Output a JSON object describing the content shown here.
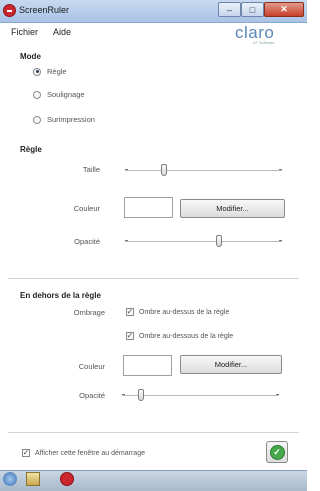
{
  "window": {
    "title": "ScreenRuler"
  },
  "menu": {
    "file": "Fichier",
    "help": "Aide"
  },
  "logo": {
    "word": "claro",
    "tagline": "AT Software"
  },
  "mode": {
    "heading": "Mode",
    "options": [
      {
        "label": "Règle",
        "selected": true
      },
      {
        "label": "Soulignage",
        "selected": false
      },
      {
        "label": "Surimpression",
        "selected": false
      }
    ]
  },
  "ruler": {
    "heading": "Règle",
    "size_label": "Taille",
    "size_level": 0.25,
    "color_label": "Couleur",
    "color_value": "#ffffff",
    "modify_button": "Modifier...",
    "opacity_label": "Opacité",
    "opacity_level": 0.6
  },
  "outside": {
    "heading": "En dehors de la règle",
    "shade_label": "Ombrage",
    "shade_above": "Ombre au-dessus de la règle",
    "shade_below": "Ombre au-dessous de la règle",
    "color_label": "Couleur",
    "color_value": "#ffffff",
    "modify_button": "Modifier...",
    "opacity_label": "Opacité",
    "opacity_level": 0.12
  },
  "footer": {
    "startup_checkbox": "Afficher cette fenêtre au démarrage"
  },
  "colors": {
    "titlebar": "#b8cfec",
    "close": "#c7402b",
    "brand": "#5b88b8",
    "ok": "#46a84a"
  }
}
